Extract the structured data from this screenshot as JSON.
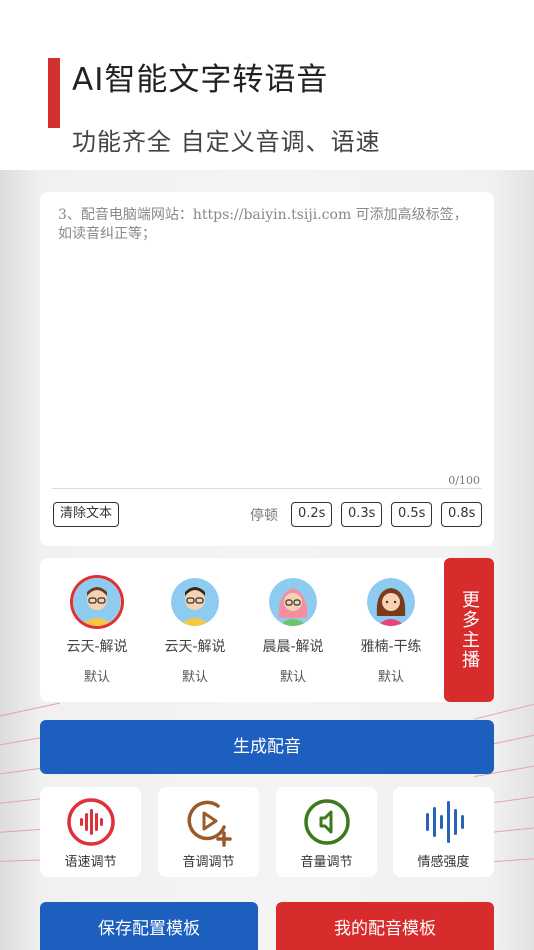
{
  "header": {
    "title": "AI智能文字转语音",
    "subtitle": "功能齐全 自定义音调、语速"
  },
  "editor": {
    "text": "3、配音电脑端网站：https://baiyin.tsiji.com 可添加高级标签，如读音纠正等；",
    "char_count": "0/100",
    "clear_label": "清除文本",
    "pause_label": "停顿",
    "pause_options": [
      "0.2s",
      "0.3s",
      "0.5s",
      "0.8s"
    ]
  },
  "voices": {
    "items": [
      {
        "name": "云天-解说",
        "tag": "默认",
        "selected": true
      },
      {
        "name": "云天-解说",
        "tag": "默认",
        "selected": false
      },
      {
        "name": "晨晨-解说",
        "tag": "默认",
        "selected": false
      },
      {
        "name": "雅楠-干练",
        "tag": "默认",
        "selected": false
      }
    ],
    "more_label": "更多主播"
  },
  "generate_label": "生成配音",
  "tools": [
    {
      "label": "语速调节",
      "icon": "speed-wave-icon",
      "color": "#e0303b"
    },
    {
      "label": "音调调节",
      "icon": "pitch-play-icon",
      "color": "#9a5a2a"
    },
    {
      "label": "音量调节",
      "icon": "volume-speaker-icon",
      "color": "#3d7a1c"
    },
    {
      "label": "情感强度",
      "icon": "emotion-bars-icon",
      "color": "#2a62b8"
    }
  ],
  "bottom": {
    "save_label": "保存配置模板",
    "mine_label": "我的配音模板"
  },
  "colors": {
    "accent_red": "#d82c2c",
    "accent_blue": "#1c5fbe"
  }
}
